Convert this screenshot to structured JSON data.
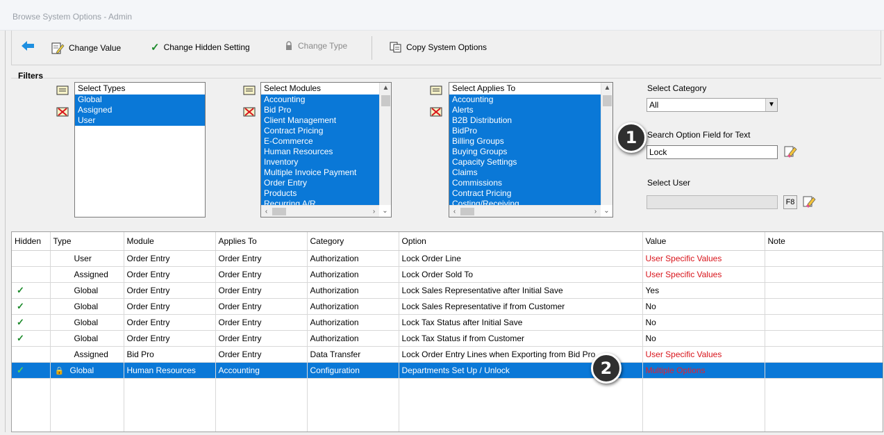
{
  "window": {
    "title": "Browse System Options - Admin"
  },
  "toolbar": {
    "change_value": "Change Value",
    "change_hidden": "Change Hidden Setting",
    "change_type": "Change Type",
    "copy_options": "Copy System Options"
  },
  "filters": {
    "label": "Filters",
    "types": {
      "header": "Select Types",
      "items": [
        "Global",
        "Assigned",
        "User"
      ]
    },
    "modules": {
      "header": "Select Modules",
      "items": [
        "Accounting",
        "Bid Pro",
        "Client Management",
        "Contract Pricing",
        "E-Commerce",
        "Human Resources",
        "Inventory",
        "Multiple Invoice Payment",
        "Order Entry",
        "Products",
        "Recurring A/R"
      ]
    },
    "applies": {
      "header": "Select Applies To",
      "items": [
        "Accounting",
        "Alerts",
        "B2B Distribution",
        "BidPro",
        "Billing Groups",
        "Buying Groups",
        "Capacity Settings",
        "Claims",
        "Commissions",
        "Contract Pricing",
        "Costing/Receiving"
      ]
    },
    "category": {
      "label": "Select Category",
      "value": "All"
    },
    "search": {
      "label": "Search Option Field for Text",
      "value": "Lock"
    },
    "user": {
      "label": "Select User",
      "value": "",
      "f8": "F8"
    }
  },
  "callouts": [
    "1",
    "2"
  ],
  "grid": {
    "columns": [
      "Hidden",
      "Type",
      "Module",
      "Applies To",
      "Category",
      "Option",
      "Value",
      "Note"
    ],
    "rows": [
      {
        "hidden": "",
        "lock": "",
        "type": "User",
        "module": "Order Entry",
        "applies": "Order Entry",
        "category": "Authorization",
        "option": "Lock Order Line",
        "value": "User Specific Values",
        "value_red": true,
        "note": ""
      },
      {
        "hidden": "",
        "lock": "",
        "type": "Assigned",
        "module": "Order Entry",
        "applies": "Order Entry",
        "category": "Authorization",
        "option": "Lock Order Sold To",
        "value": "User Specific Values",
        "value_red": true,
        "note": ""
      },
      {
        "hidden": "✓",
        "lock": "",
        "type": "Global",
        "module": "Order Entry",
        "applies": "Order Entry",
        "category": "Authorization",
        "option": "Lock Sales Representative after Initial Save",
        "value": "Yes",
        "value_red": false,
        "note": ""
      },
      {
        "hidden": "✓",
        "lock": "",
        "type": "Global",
        "module": "Order Entry",
        "applies": "Order Entry",
        "category": "Authorization",
        "option": "Lock Sales Representative if from Customer",
        "value": "No",
        "value_red": false,
        "note": ""
      },
      {
        "hidden": "✓",
        "lock": "",
        "type": "Global",
        "module": "Order Entry",
        "applies": "Order Entry",
        "category": "Authorization",
        "option": "Lock Tax Status after Initial Save",
        "value": "No",
        "value_red": false,
        "note": ""
      },
      {
        "hidden": "✓",
        "lock": "",
        "type": "Global",
        "module": "Order Entry",
        "applies": "Order Entry",
        "category": "Authorization",
        "option": "Lock Tax Status if from Customer",
        "value": "No",
        "value_red": false,
        "note": ""
      },
      {
        "hidden": "",
        "lock": "",
        "type": "Assigned",
        "module": "Bid Pro",
        "applies": "Order Entry",
        "category": "Data Transfer",
        "option": "Lock Order Entry Lines when Exporting from Bid Pro",
        "value": "User Specific Values",
        "value_red": true,
        "note": ""
      },
      {
        "hidden": "✓",
        "lock": "🔒",
        "type": "Global",
        "module": "Human Resources",
        "applies": "Accounting",
        "category": "Configuration",
        "option": "Departments Set Up / Unlock",
        "value": "Multiple Options",
        "value_red": true,
        "note": "",
        "selected": true
      }
    ]
  },
  "colors": {
    "selection": "#0a78d7",
    "red_value": "#d8131a",
    "check_green": "#1b8a2a"
  }
}
